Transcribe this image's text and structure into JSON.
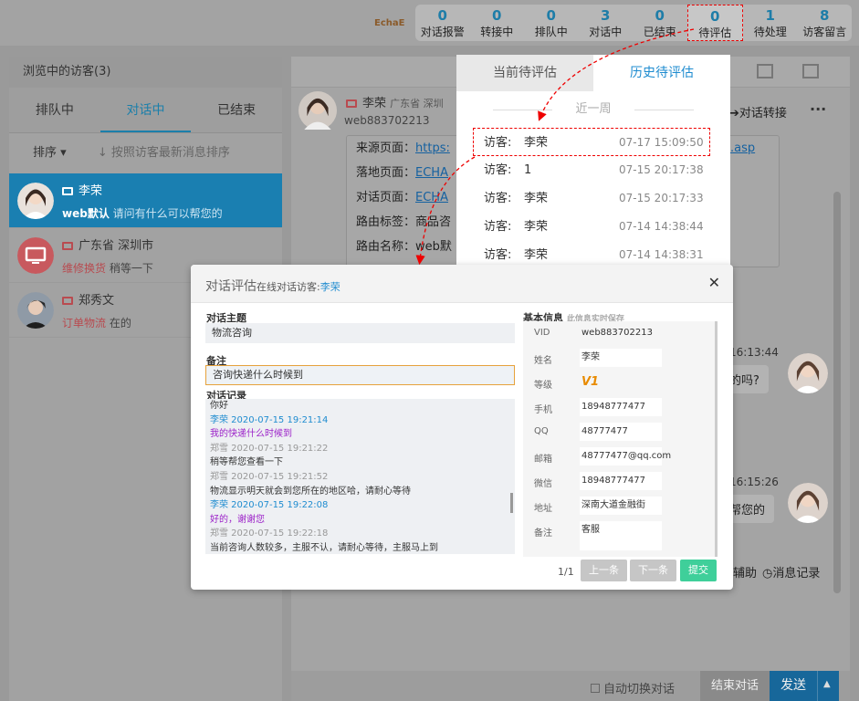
{
  "brand": "EchaE",
  "stats": [
    {
      "value": "0",
      "label": "对话报警"
    },
    {
      "value": "0",
      "label": "转接中"
    },
    {
      "value": "0",
      "label": "排队中"
    },
    {
      "value": "3",
      "label": "对话中"
    },
    {
      "value": "0",
      "label": "已结束"
    },
    {
      "value": "0",
      "label": "待评估"
    },
    {
      "value": "1",
      "label": "待处理"
    },
    {
      "value": "8",
      "label": "访客留言"
    }
  ],
  "left": {
    "title": "浏览中的访客(3)",
    "tabs": [
      "排队中",
      "对话中",
      "已结束"
    ],
    "sort_label": "排序",
    "sort_hint": "按照访客最新消息排序",
    "visitors": [
      {
        "name": "李荣",
        "tag": "web默认",
        "msg": "请问有什么可以帮您的"
      },
      {
        "name": "广东省 深圳市",
        "tag": "维修换货",
        "msg": "稍等一下"
      },
      {
        "name": "郑秀文",
        "tag": "订单物流",
        "msg": "在的"
      }
    ]
  },
  "center": {
    "visitor_name": "李荣",
    "visitor_region": "广东省 深圳",
    "visitor_id": "web883702213",
    "transfer": "对话转接",
    "rows": [
      {
        "k": "来源页面：",
        "v": "https:",
        "tail": ".asp"
      },
      {
        "k": "落地页面：",
        "v": "ECHA"
      },
      {
        "k": "对话页面：",
        "v": "ECHA"
      },
      {
        "k": "路由标签：",
        "v": "商品咨"
      },
      {
        "k": "路由名称：",
        "v": "web默"
      }
    ],
    "time1": "16:13:44",
    "bubble1": "的吗?",
    "time2": "16:15:26",
    "bubble2": "帮您的",
    "assist": "辅助",
    "msg_log": "消息记录",
    "auto_switch": "自动切换对话",
    "end_chat": "结束对话",
    "send": "发送"
  },
  "eval_popup": {
    "tab_current": "当前待评估",
    "tab_history": "历史待评估",
    "week": "近一周",
    "visitor_label": "访客:",
    "rows": [
      {
        "name": "李荣",
        "time": "07-17 15:09:50"
      },
      {
        "name": "1",
        "time": "07-15 20:17:38"
      },
      {
        "name": "李荣",
        "time": "07-15 20:17:33"
      },
      {
        "name": "李荣",
        "time": "07-14 14:38:44"
      },
      {
        "name": "李荣",
        "time": "07-14 14:38:31"
      }
    ]
  },
  "dialog": {
    "title": "对话评估",
    "subtitle": "在线对话访客:",
    "visitor": "李荣",
    "topic_label": "对话主题",
    "topic": "物流咨询",
    "note_label": "备注",
    "note": "咨询快递什么时候到",
    "log_label": "对话记录",
    "log": [
      {
        "text": "你好",
        "cls": "c-dark"
      },
      {
        "text": "李荣    2020-07-15 19:21:14",
        "cls": "c-blue"
      },
      {
        "text": "我的快递什么时候到",
        "cls": "c-purple"
      },
      {
        "text": "郑雪    2020-07-15 19:21:22",
        "cls": "c-gray"
      },
      {
        "text": "稍等帮您查看一下",
        "cls": "c-dark"
      },
      {
        "text": "郑雪    2020-07-15 19:21:52",
        "cls": "c-gray"
      },
      {
        "text": "物流显示明天就会到您所在的地区哈，请耐心等待",
        "cls": "c-dark"
      },
      {
        "text": "李荣    2020-07-15 19:22:08",
        "cls": "c-blue"
      },
      {
        "text": "好的，谢谢您",
        "cls": "c-purple"
      },
      {
        "text": "郑雪    2020-07-15 19:22:18",
        "cls": "c-gray"
      },
      {
        "text": "当前咨询人数较多，主服不认，请耐心等待，主服马上到",
        "cls": "c-dark"
      }
    ],
    "basic_label": "基本信息",
    "basic_hint": "此信息实时保存",
    "basic": [
      {
        "k": "VID",
        "v": "web883702213",
        "style": "plain"
      },
      {
        "k": "姓名",
        "v": "李荣",
        "style": "box"
      },
      {
        "k": "等级",
        "v": "V1",
        "style": "tag"
      },
      {
        "k": "手机",
        "v": "18948777477",
        "style": "box"
      },
      {
        "k": "QQ",
        "v": "48777477",
        "style": "box"
      },
      {
        "k": "邮箱",
        "v": "48777477@qq.com",
        "style": "box"
      },
      {
        "k": "微信",
        "v": "18948777477",
        "style": "box"
      },
      {
        "k": "地址",
        "v": "深南大道金融街",
        "style": "box"
      },
      {
        "k": "备注",
        "v": "客服",
        "style": "box"
      }
    ],
    "pager": "1/1",
    "prev": "上一条",
    "next": "下一条",
    "submit": "提交",
    "colors": {
      "submit": "#3fcf9a",
      "btn": "#c6c6c6",
      "accent": "#1f8cd0"
    }
  }
}
